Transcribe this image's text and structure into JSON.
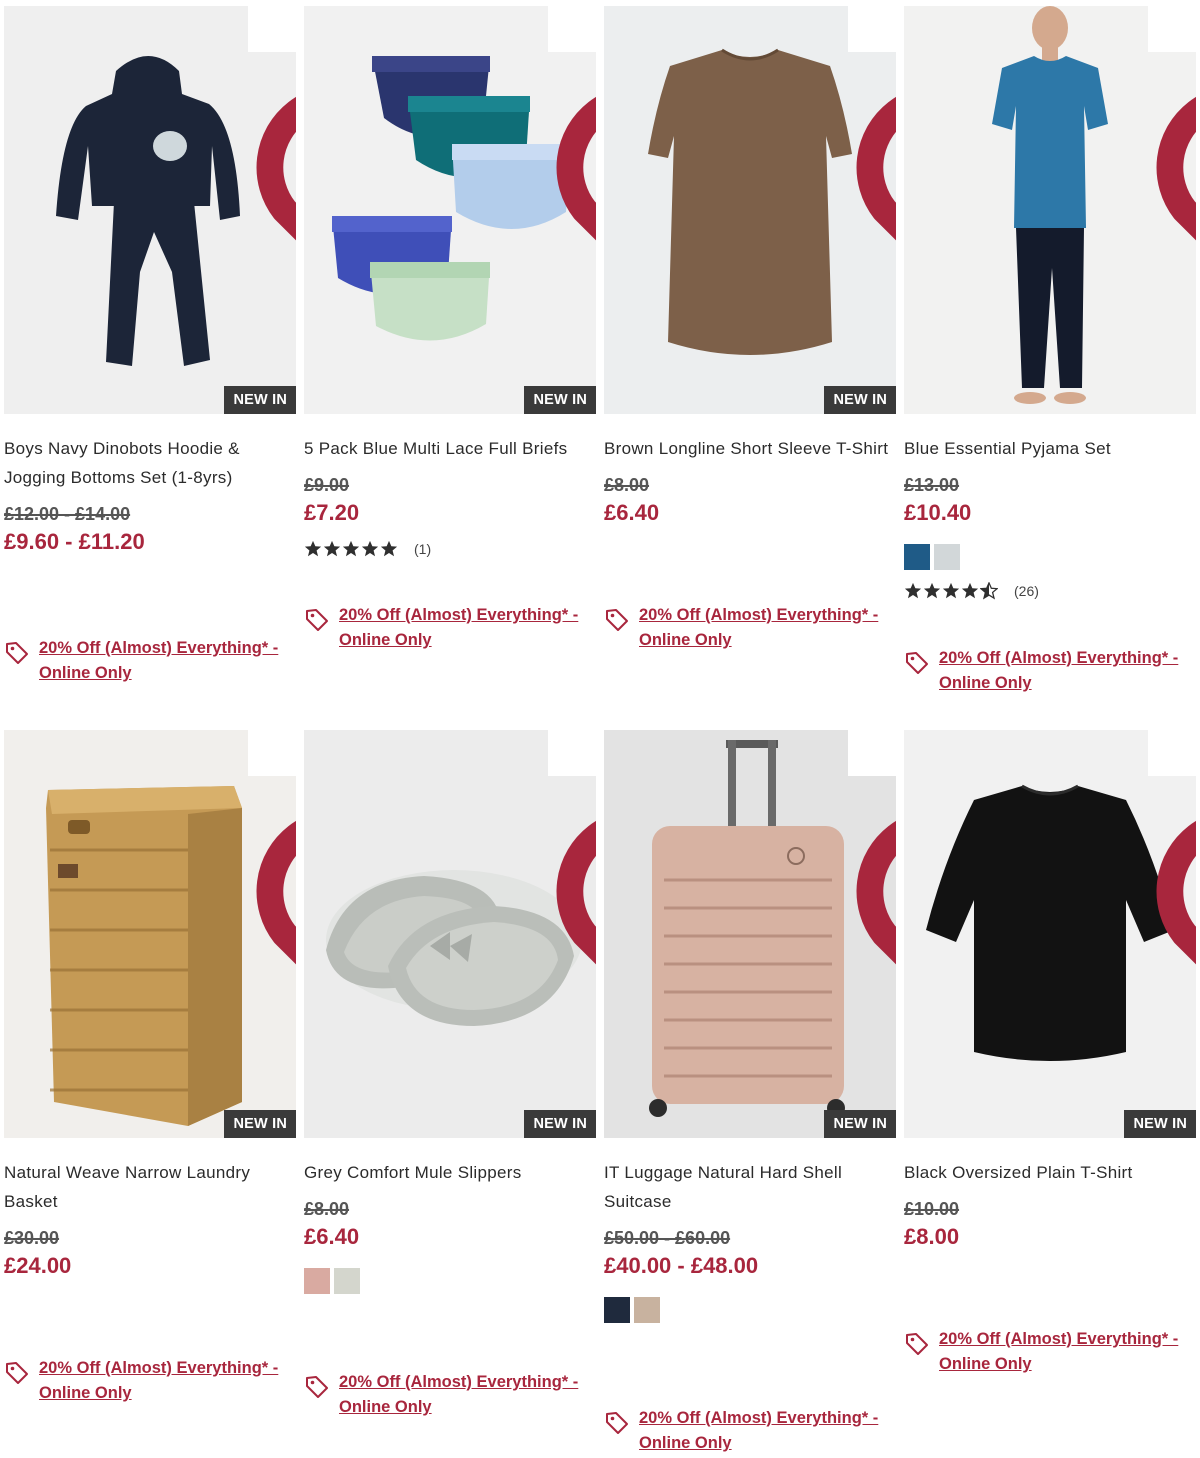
{
  "products": [
    {
      "title": "Boys Navy Dinobots Hoodie & Jogging Bottoms Set (1-8yrs)",
      "was": "£12.00 - £14.00",
      "now": "£9.60 - £11.20",
      "badge": "NEW IN",
      "promo": "20% Off (Almost) Everything* - Online Only",
      "image": "navy-hoodie-set"
    },
    {
      "title": "5 Pack Blue Multi Lace Full Briefs",
      "was": "£9.00",
      "now": "£7.20",
      "badge": "NEW IN",
      "rating": {
        "stars": 5,
        "count": "(1)"
      },
      "promo": "20% Off (Almost) Everything* - Online Only",
      "image": "lace-briefs"
    },
    {
      "title": "Brown Longline Short Sleeve T-Shirt",
      "was": "£8.00",
      "now": "£6.40",
      "badge": "NEW IN",
      "promo": "20% Off (Almost) Everything* - Online Only",
      "image": "brown-tshirt"
    },
    {
      "title": "Blue Essential Pyjama Set",
      "was": "£13.00",
      "now": "£10.40",
      "swatches": [
        "#1f5b87",
        "#d2d7d9"
      ],
      "rating": {
        "stars": 4.5,
        "count": "(26)"
      },
      "promo": "20% Off (Almost) Everything* - Online Only",
      "image": "pyjama-set"
    },
    {
      "title": "Natural Weave Narrow Laundry Basket",
      "was": "£30.00",
      "now": "£24.00",
      "badge": "NEW IN",
      "promo": "20% Off (Almost) Everything* - Online Only",
      "image": "laundry-basket"
    },
    {
      "title": "Grey Comfort Mule Slippers",
      "was": "£8.00",
      "now": "£6.40",
      "badge": "NEW IN",
      "swatches": [
        "#d9aaa1",
        "#d4d6cd"
      ],
      "promo": "20% Off (Almost) Everything* - Online Only",
      "image": "slippers"
    },
    {
      "title": "IT Luggage Natural Hard Shell Suitcase",
      "was": "£50.00 - £60.00",
      "now": "£40.00 - £48.00",
      "badge": "NEW IN",
      "swatches": [
        "#1f2a3d",
        "#c8b29f"
      ],
      "promo": "20% Off (Almost) Everything* - Online Only",
      "image": "suitcase"
    },
    {
      "title": "Black Oversized Plain T-Shirt",
      "was": "£10.00",
      "now": "£8.00",
      "badge": "NEW IN",
      "promo": "20% Off (Almost) Everything* - Online Only",
      "image": "black-tshirt"
    }
  ],
  "colors": {
    "accent": "#a8263d",
    "badge_bg": "#3a3a3a"
  },
  "icons": {
    "wishlist": "heart-icon",
    "promo": "tag-icon",
    "rating": "star-icon"
  }
}
